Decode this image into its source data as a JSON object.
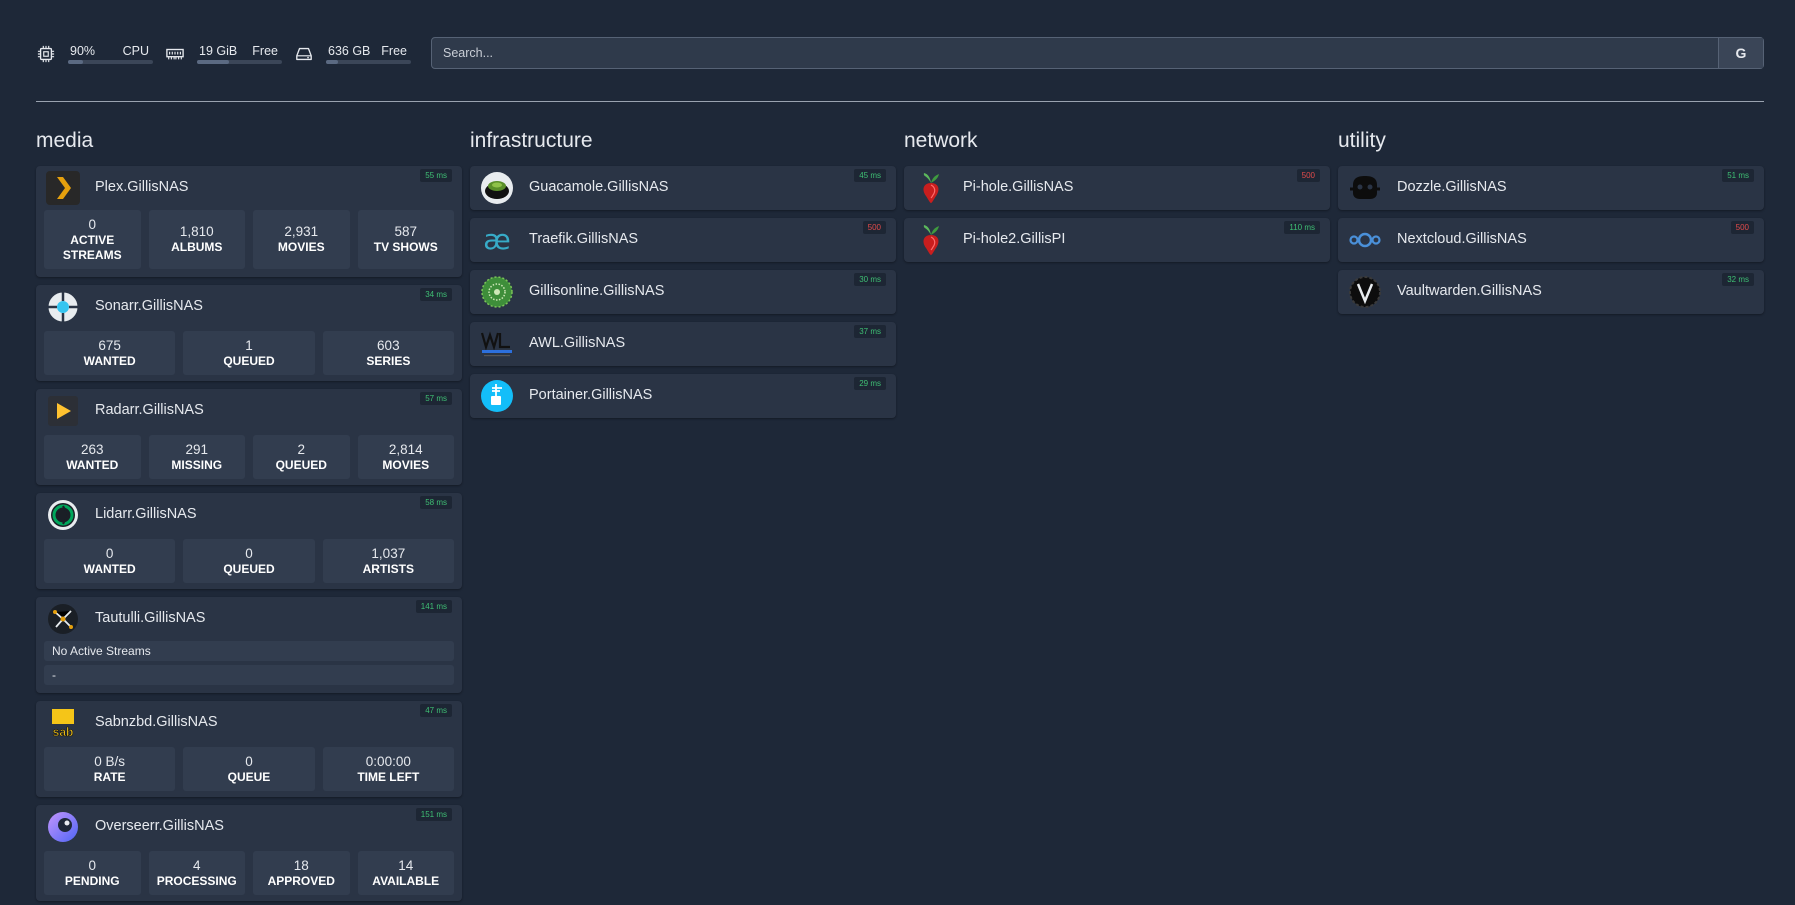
{
  "resources": {
    "cpu": {
      "value": "90%",
      "label": "CPU",
      "fill": 0.18
    },
    "memory": {
      "value": "19 GiB",
      "label": "Free",
      "fill": 0.38
    },
    "disk": {
      "value": "636 GB",
      "label": "Free",
      "fill": 0.14
    }
  },
  "search": {
    "placeholder": "Search...",
    "button": "G"
  },
  "groups": {
    "media": {
      "title": "media",
      "plex": {
        "name": "Plex.GillisNAS",
        "ping": "55 ms",
        "stats": [
          {
            "v": "0",
            "l": "ACTIVE STREAMS"
          },
          {
            "v": "1,810",
            "l": "ALBUMS"
          },
          {
            "v": "2,931",
            "l": "MOVIES"
          },
          {
            "v": "587",
            "l": "TV SHOWS"
          }
        ]
      },
      "sonarr": {
        "name": "Sonarr.GillisNAS",
        "ping": "34 ms",
        "stats": [
          {
            "v": "675",
            "l": "WANTED"
          },
          {
            "v": "1",
            "l": "QUEUED"
          },
          {
            "v": "603",
            "l": "SERIES"
          }
        ]
      },
      "radarr": {
        "name": "Radarr.GillisNAS",
        "ping": "57 ms",
        "stats": [
          {
            "v": "263",
            "l": "WANTED"
          },
          {
            "v": "291",
            "l": "MISSING"
          },
          {
            "v": "2",
            "l": "QUEUED"
          },
          {
            "v": "2,814",
            "l": "MOVIES"
          }
        ]
      },
      "lidarr": {
        "name": "Lidarr.GillisNAS",
        "ping": "58 ms",
        "stats": [
          {
            "v": "0",
            "l": "WANTED"
          },
          {
            "v": "0",
            "l": "QUEUED"
          },
          {
            "v": "1,037",
            "l": "ARTISTS"
          }
        ]
      },
      "tautulli": {
        "name": "Tautulli.GillisNAS",
        "ping": "141 ms",
        "line1": "No Active Streams",
        "line2": "-"
      },
      "sabnzbd": {
        "name": "Sabnzbd.GillisNAS",
        "ping": "47 ms",
        "stats": [
          {
            "v": "0 B/s",
            "l": "RATE"
          },
          {
            "v": "0",
            "l": "QUEUE"
          },
          {
            "v": "0:00:00",
            "l": "TIME LEFT"
          }
        ]
      },
      "overseerr": {
        "name": "Overseerr.GillisNAS",
        "ping": "151 ms",
        "stats": [
          {
            "v": "0",
            "l": "PENDING"
          },
          {
            "v": "4",
            "l": "PROCESSING"
          },
          {
            "v": "18",
            "l": "APPROVED"
          },
          {
            "v": "14",
            "l": "AVAILABLE"
          }
        ]
      }
    },
    "infrastructure": {
      "title": "infrastructure",
      "services": [
        {
          "name": "Guacamole.GillisNAS",
          "ping": "45 ms"
        },
        {
          "name": "Traefik.GillisNAS",
          "ping": "500"
        },
        {
          "name": "Gillisonline.GillisNAS",
          "ping": "30 ms"
        },
        {
          "name": "AWL.GillisNAS",
          "ping": "37 ms"
        },
        {
          "name": "Portainer.GillisNAS",
          "ping": "29 ms"
        }
      ]
    },
    "network": {
      "title": "network",
      "services": [
        {
          "name": "Pi-hole.GillisNAS",
          "ping": "500"
        },
        {
          "name": "Pi-hole2.GillisPI",
          "ping": "110 ms"
        }
      ]
    },
    "utility": {
      "title": "utility",
      "services": [
        {
          "name": "Dozzle.GillisNAS",
          "ping": "51 ms"
        },
        {
          "name": "Nextcloud.GillisNAS",
          "ping": "500"
        },
        {
          "name": "Vaultwarden.GillisNAS",
          "ping": "32 ms"
        }
      ]
    }
  },
  "colors": {
    "background": "#1e2838",
    "card": "#2a3445",
    "ping_ok": "#3fbf74",
    "ping_error": "#e24b4b"
  }
}
